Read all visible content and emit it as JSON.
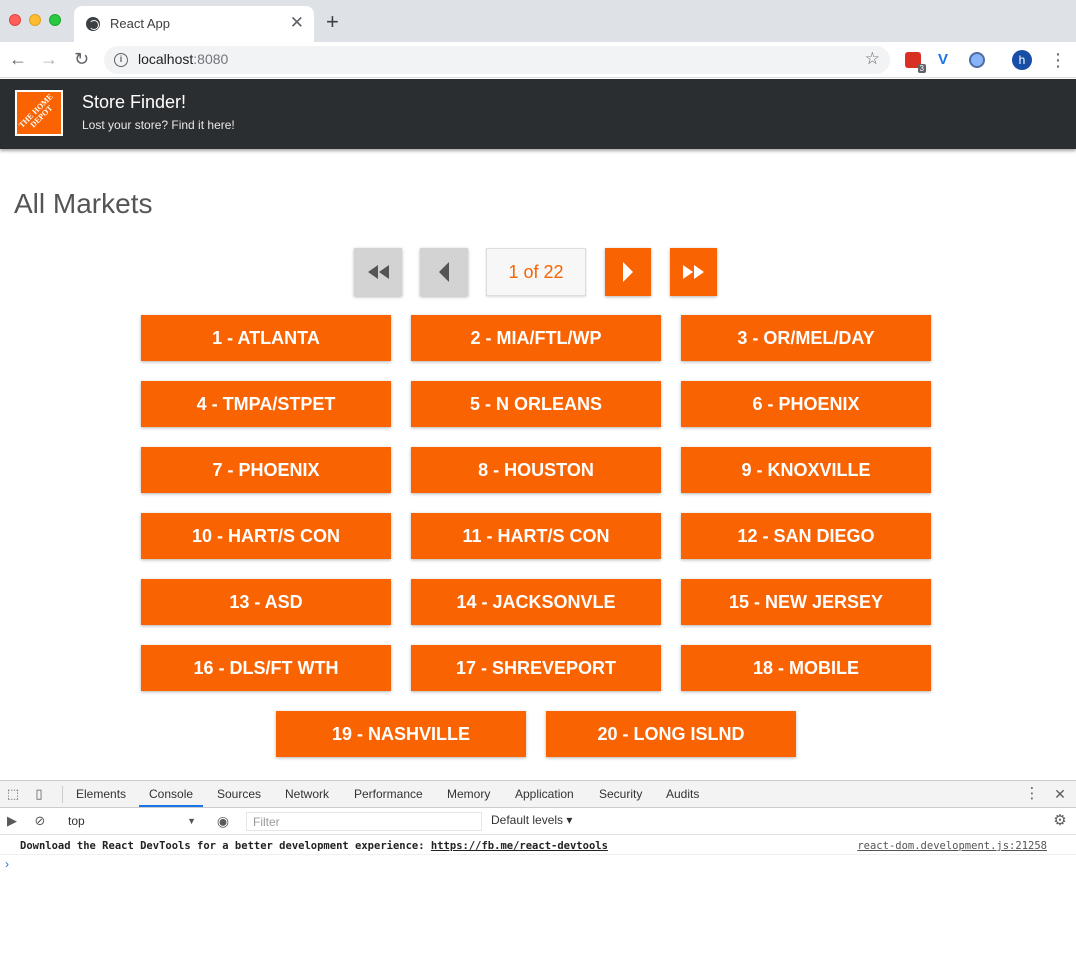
{
  "browser": {
    "tab_title": "React App",
    "tab_close": "✕",
    "new_tab": "+",
    "url_host": "localhost",
    "url_port": ":8080",
    "ext_badge": "3",
    "profile_initial": "h"
  },
  "header": {
    "logo_text": "THE HOME DEPOT",
    "title": "Store Finder!",
    "subtitle": "Lost your store? Find it here!"
  },
  "main": {
    "heading": "All Markets",
    "pagination": {
      "indicator": "1 of 22",
      "current_page": 1,
      "total_pages": 22
    },
    "markets": [
      "1 - ATLANTA",
      "2 - MIA/FTL/WP",
      "3 - OR/MEL/DAY",
      "4 - TMPA/STPET",
      "5 - N ORLEANS",
      "6 - PHOENIX",
      "7 - PHOENIX",
      "8 - HOUSTON",
      "9 - KNOXVILLE",
      "10 - HART/S CON",
      "11 - HART/S CON",
      "12 - SAN DIEGO",
      "13 - ASD",
      "14 - JACKSONVLE",
      "15 - NEW JERSEY",
      "16 - DLS/FT WTH",
      "17 - SHREVEPORT",
      "18 - MOBILE",
      "19 - NASHVILLE",
      "20 - LONG ISLND"
    ]
  },
  "devtools": {
    "tabs": [
      "Elements",
      "Console",
      "Sources",
      "Network",
      "Performance",
      "Memory",
      "Application",
      "Security",
      "Audits"
    ],
    "selected_tab": "Console",
    "context": "top",
    "filter_placeholder": "Filter",
    "levels": "Default levels ▾",
    "message": "Download the React DevTools for a better development experience: ",
    "message_link": "https://fb.me/react-devtools",
    "source": "react-dom.development.js:21258",
    "prompt": "›"
  },
  "colors": {
    "accent": "#f96302",
    "header_bg": "#2b2e30",
    "disabled": "#d3d3d3"
  }
}
